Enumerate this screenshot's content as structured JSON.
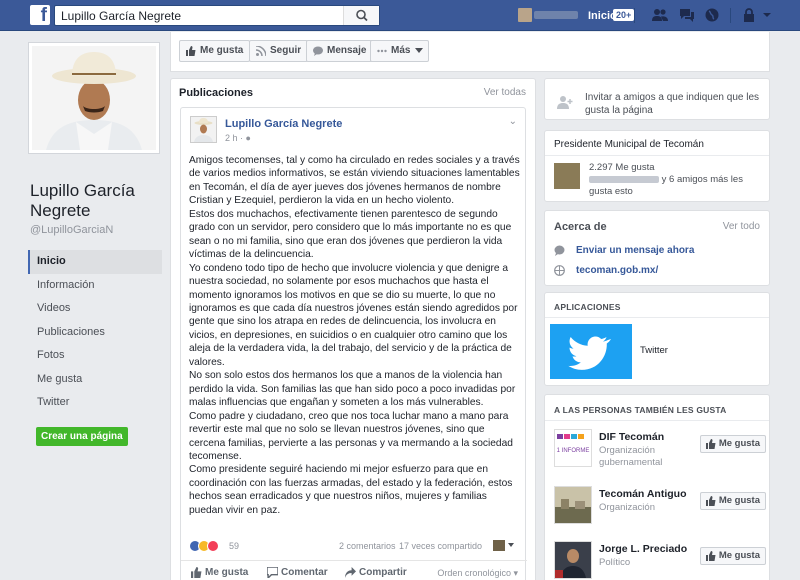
{
  "topbar": {
    "search_value": "Lupillo García Negrete",
    "home_label": "Inicio",
    "home_badge": "20+"
  },
  "profile": {
    "name": "Lupillo García Negrete",
    "handle": "@LupilloGarciaN",
    "nav": [
      "Inicio",
      "Información",
      "Videos",
      "Publicaciones",
      "Fotos",
      "Me gusta",
      "Twitter"
    ],
    "create_page": "Crear una página"
  },
  "actions": {
    "like": "Me gusta",
    "follow": "Seguir",
    "message": "Mensaje",
    "more": "Más"
  },
  "posts_section": {
    "title": "Publicaciones",
    "see_all": "Ver todas"
  },
  "post": {
    "author": "Lupillo García Negrete",
    "time": "2 h",
    "text": "Amigos tecomenses, tal y como ha circulado en redes sociales y a través de varios medios informativos, se están viviendo situaciones lamentables en Tecomán, el día de ayer jueves dos jóvenes hermanos de nombre Cristian y Ezequiel, perdieron la vida en un hecho violento.\nEstos dos muchachos, efectivamente tienen parentesco de segundo grado con un servidor, pero considero que lo más importante no es que sean o no mi familia, sino que eran dos jóvenes que perdieron la vida víctimas de la delincuencia.\nYo condeno todo tipo de hecho que involucre violencia y que denigre a nuestra sociedad, no solamente por esos muchachos que hasta el momento ignoramos los motivos en que se dio su muerte, lo que no ignoramos es que cada día nuestros jóvenes están siendo agredidos por gente que sino los atrapa en redes de delincuencia, los involucra en vicios, en depresiones, en suicidios o en cualquier otro camino que los aleja de la verdadera vida, la del trabajo, del servicio y de la práctica de valores.\nNo son solo estos dos hermanos los que a manos de la violencia han perdido la vida. Son familias las que han sido poco a poco invadidas por malas influencias que engañan y someten a los más vulnerables.\nComo padre y ciudadano, creo que nos toca luchar mano a mano para revertir este mal que no solo se llevan nuestros jóvenes, sino que cercena familias, pervierte a las personas y va mermando a la sociedad tecomense.\nComo presidente seguiré haciendo mi mejor esfuerzo para que en coordinación con las fuerzas armadas, del estado y la federación, estos hechos sean erradicados y que nuestros niños, mujeres y familias puedan vivir en paz.",
    "reaction_count": "59",
    "comments": "2 comentarios",
    "shares": "17 veces compartido",
    "like_action": "Me gusta",
    "comment_action": "Comentar",
    "share_action": "Compartir",
    "order": "Orden cronológico"
  },
  "sidebar": {
    "invite": "Invitar a amigos a que indiquen que les gusta la página",
    "category": "Presidente Municipal de Tecomán",
    "likes_count": "2.297 Me gusta",
    "friends_suffix": "y 6 amigos más les gusta esto",
    "about_title": "Acerca de",
    "about_see_all": "Ver todo",
    "about_message": "Enviar un mensaje ahora",
    "about_website": "tecoman.gob.mx/",
    "apps_title": "APLICACIONES",
    "app_twitter": "Twitter",
    "also_title": "A LAS PERSONAS TAMBIÉN LES GUSTA",
    "also_pages": [
      {
        "name": "DIF Tecomán",
        "category": "Organización gubernamental",
        "button": "Me gusta"
      },
      {
        "name": "Tecomán Antiguo",
        "category": "Organización",
        "button": "Me gusta"
      },
      {
        "name": "Jorge L. Preciado",
        "category": "Político",
        "button": "Me gusta"
      }
    ],
    "dif_logo_text": "1 INFORME"
  },
  "colors": {
    "brand_blue": "#3b5998",
    "link_blue": "#365899",
    "green_button": "#42b72a",
    "twitter_blue": "#1da1f2"
  }
}
